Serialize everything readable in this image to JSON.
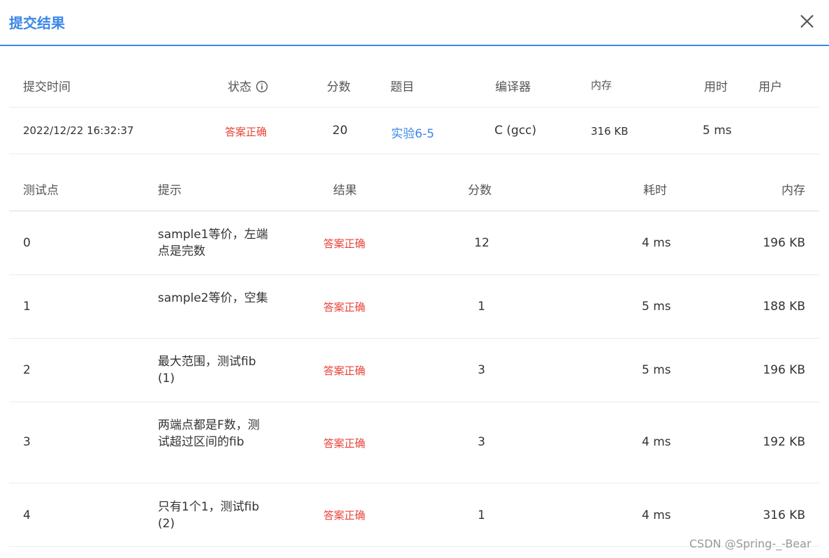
{
  "dialog": {
    "title": "提交结果",
    "close_icon": "close-icon"
  },
  "summary": {
    "headers": {
      "time": "提交时间",
      "status": "状态",
      "score": "分数",
      "problem": "题目",
      "compiler": "编译器",
      "memory": "内存",
      "duration": "用时",
      "user": "用户"
    },
    "row": {
      "time": "2022/12/22 16:32:37",
      "status": "答案正确",
      "score": "20",
      "problem": "实验6-5",
      "compiler": "C (gcc)",
      "memory": "316 KB",
      "duration": "5 ms",
      "user": ""
    }
  },
  "tests": {
    "headers": {
      "id": "测试点",
      "hint": "提示",
      "result": "结果",
      "score": "分数",
      "time": "耗时",
      "memory": "内存"
    },
    "rows": [
      {
        "id": "0",
        "hint": "sample1等价，左端点是完数",
        "result": "答案正确",
        "score": "12",
        "time": "4 ms",
        "memory": "196 KB"
      },
      {
        "id": "1",
        "hint": "sample2等价，空集",
        "result": "答案正确",
        "score": "1",
        "time": "5 ms",
        "memory": "188 KB"
      },
      {
        "id": "2",
        "hint": "最大范围，测试fib(1)",
        "result": "答案正确",
        "score": "3",
        "time": "5 ms",
        "memory": "196 KB"
      },
      {
        "id": "3",
        "hint": "两端点都是F数，测试超过区间的fib",
        "result": "答案正确",
        "score": "3",
        "time": "4 ms",
        "memory": "192 KB"
      },
      {
        "id": "4",
        "hint": "只有1个1，测试fib(2)",
        "result": "答案正确",
        "score": "1",
        "time": "4 ms",
        "memory": "316 KB"
      }
    ]
  },
  "watermark": "CSDN @Spring-_-Bear",
  "colors": {
    "accent": "#3c87e6",
    "success_text": "#e8433a",
    "divider": "#e9ecef"
  }
}
